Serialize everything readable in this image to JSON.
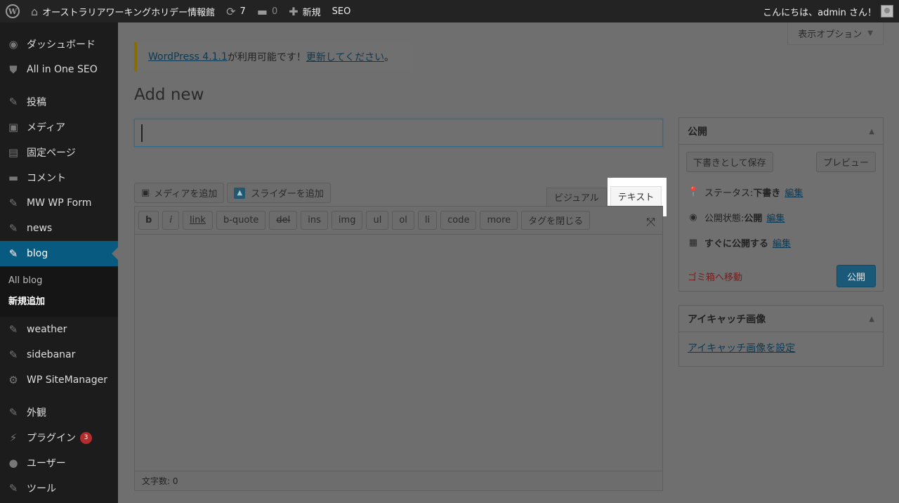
{
  "adminbar": {
    "wp_logo": "W",
    "site_name": "オーストラリアワーキングホリデー情報館",
    "updates_count": "7",
    "comments_count": "0",
    "new_label": "新規",
    "seo_label": "SEO",
    "greeting": "こんにちは、admin さん！"
  },
  "sidebar": {
    "items": [
      {
        "label": "ダッシュボード",
        "icon": "dashboard-icon"
      },
      {
        "label": "All in One SEO",
        "icon": "shield-icon"
      },
      {
        "label": "投稿",
        "icon": "pin-icon"
      },
      {
        "label": "メディア",
        "icon": "media-icon"
      },
      {
        "label": "固定ページ",
        "icon": "page-icon"
      },
      {
        "label": "コメント",
        "icon": "comment-icon"
      },
      {
        "label": "MW WP Form",
        "icon": "pin-icon"
      },
      {
        "label": "news",
        "icon": "pin-icon"
      },
      {
        "label": "blog",
        "icon": "pin-icon"
      },
      {
        "label": "weather",
        "icon": "pin-icon"
      },
      {
        "label": "sidebanar",
        "icon": "pin-icon"
      },
      {
        "label": "WP SiteManager",
        "icon": "gear-icon"
      },
      {
        "label": "外観",
        "icon": "brush-icon"
      },
      {
        "label": "プラグイン",
        "icon": "plugin-icon"
      },
      {
        "label": "ユーザー",
        "icon": "user-icon"
      },
      {
        "label": "ツール",
        "icon": "wrench-icon"
      }
    ],
    "blog_sub": [
      "All blog",
      "新規追加"
    ],
    "plugin_badge": "3"
  },
  "main": {
    "screen_options": "表示オプション",
    "notice": {
      "link1": "WordPress 4.1.1",
      "middle": " が利用可能です！",
      "link2": "更新してください",
      "end": "。"
    },
    "title": "Add new",
    "title_input_value": "",
    "media_button": "メディアを追加",
    "slider_button": "スライダーを追加",
    "tabs": {
      "visual": "ビジュアル",
      "text": "テキスト"
    },
    "quicktags": [
      "b",
      "i",
      "link",
      "b-quote",
      "del",
      "ins",
      "img",
      "ul",
      "ol",
      "li",
      "code",
      "more",
      "タグを閉じる"
    ],
    "word_count": "文字数: 0"
  },
  "publish_box": {
    "title": "公開",
    "save_draft": "下書きとして保存",
    "preview": "プレビュー",
    "status_label": "ステータス: ",
    "status_value": "下書き",
    "visibility_label": "公開状態: ",
    "visibility_value": "公開",
    "schedule_label": "すぐに公開する",
    "edit": "編集",
    "trash": "ゴミ箱へ移動",
    "publish": "公開"
  },
  "thumbnail_box": {
    "title": "アイキャッチ画像",
    "set_link": "アイキャッチ画像を設定"
  }
}
